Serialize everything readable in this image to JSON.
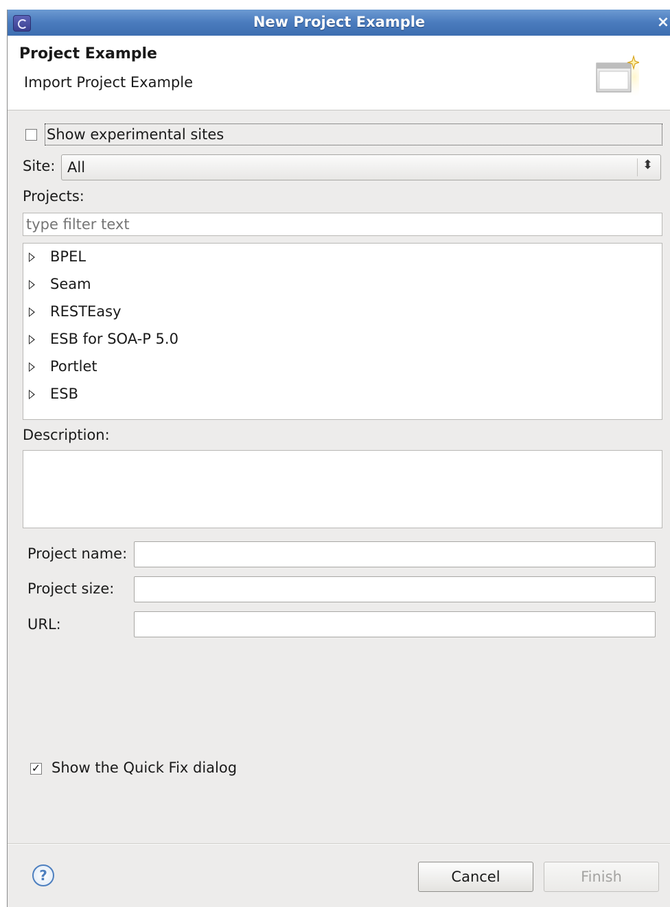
{
  "window": {
    "title": "New Project Example",
    "close_glyph": "×"
  },
  "header": {
    "title": "Project Example",
    "subtitle": "Import Project Example",
    "icon": "new-wizard-icon"
  },
  "show_experimental": {
    "label": "Show experimental sites",
    "checked": false
  },
  "site": {
    "label": "Site:",
    "value": "All"
  },
  "projects": {
    "label": "Projects:",
    "filter_placeholder": "type filter text",
    "items": [
      {
        "label": "BPEL"
      },
      {
        "label": "Seam"
      },
      {
        "label": "RESTEasy"
      },
      {
        "label": "ESB for SOA-P 5.0"
      },
      {
        "label": "Portlet"
      },
      {
        "label": "ESB"
      }
    ]
  },
  "description": {
    "label": "Description:"
  },
  "fields": {
    "name_label": "Project name:",
    "size_label": "Project size:",
    "url_label": "URL:"
  },
  "quick_fix": {
    "label": "Show the Quick Fix dialog",
    "checked": true
  },
  "footer": {
    "help_glyph": "?",
    "cancel_label": "Cancel",
    "finish_label": "Finish"
  }
}
